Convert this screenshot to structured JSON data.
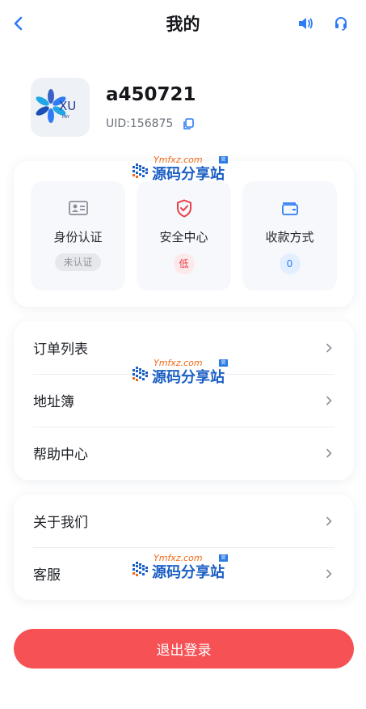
{
  "header": {
    "title": "我的",
    "back_icon": "chevron-left-icon",
    "sound_icon": "speaker-icon",
    "service_icon": "headset-icon"
  },
  "profile": {
    "username": "a450721",
    "uid": "UID:156875",
    "avatar_logo_text": "XU",
    "avatar_logo_subtext": "PAY"
  },
  "quick_actions": [
    {
      "label": "身份认证",
      "badge": "未认证",
      "icon": "id-card-icon"
    },
    {
      "label": "安全中心",
      "badge": "低",
      "icon": "shield-icon"
    },
    {
      "label": "收款方式",
      "badge": "0",
      "icon": "wallet-icon"
    }
  ],
  "menu_group_1": [
    {
      "label": "订单列表"
    },
    {
      "label": "地址簿"
    },
    {
      "label": "帮助中心"
    }
  ],
  "menu_group_2": [
    {
      "label": "关于我们"
    },
    {
      "label": "客服"
    }
  ],
  "logout_label": "退出登录",
  "watermark": {
    "domain": "Ymfxz.com",
    "badge": "官网",
    "name": "源码分享站"
  },
  "colors": {
    "accent_blue": "#2f7bf5",
    "danger_red": "#e8404b",
    "logout_bg": "#f65256"
  }
}
